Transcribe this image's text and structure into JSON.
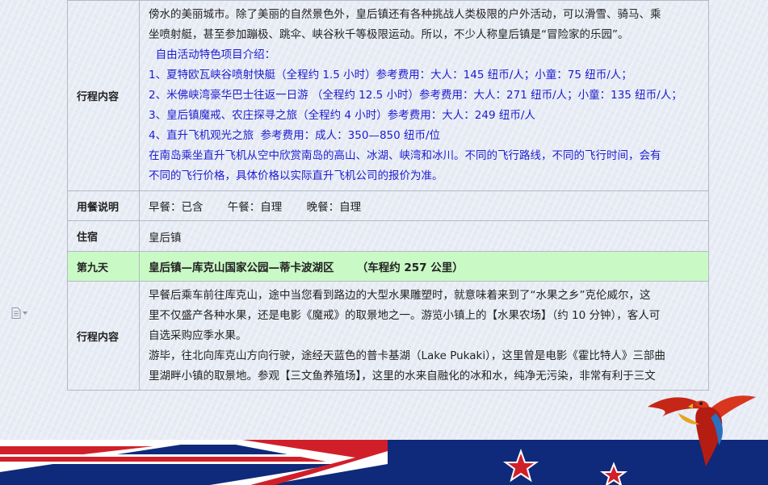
{
  "rows": [
    {
      "label": "行程内容",
      "lines": [
        "傍水的美丽城市。除了美丽的自然景色外，皇后镇还有各种挑战人类极限的户外活动，可以滑雪、骑马、乘",
        "坐喷射艇，甚至参加蹦极、跳伞、峡谷秋千等极限运动。所以，不少人称皇后镇是“冒险家的乐园”。"
      ],
      "blue_lines": [
        "  自由活动特色项目介绍：",
        "1、夏特欧瓦峡谷喷射快艇（全程约 1.5 小时）参考费用：大人：145 纽币/人；小童：75 纽币/人；",
        "2、米佛峡湾豪华巴士往返一日游 （全程约 12.5 小时）参考费用：大人：271 纽币/人；小童：135 纽币/人；",
        "3、皇后镇魔戒、农庄探寻之旅（全程约 4 小时）参考费用：大人：249 纽币/人",
        "4、直升飞机观光之旅  参考费用：成人：350—850 纽币/位",
        "在南岛乘坐直升飞机从空中欣赏南岛的高山、冰湖、峡湾和冰川。不同的飞行路线，不同的飞行时间，会有",
        "不同的飞行价格，具体价格以实际直升飞机公司的报价为准。"
      ]
    },
    {
      "label": "用餐说明",
      "meals": [
        "早餐：已含",
        "午餐：自理",
        "晚餐：自理"
      ]
    },
    {
      "label": "住宿",
      "text": "皇后镇"
    },
    {
      "label": "第九天",
      "title": "皇后镇—库克山国家公园—蒂卡波湖区      （车程约 257 公里）"
    },
    {
      "label": "行程内容",
      "lines": [
        "早餐后乘车前往库克山，途中当您看到路边的大型水果雕塑时，就意味着来到了“水果之乡”克伦威尔，这",
        "里不仅盛产各种水果，还是电影《魔戒》的取景地之一。游览小镇上的【水果农场】（约 10 分钟），客人可",
        "自选采购应季水果。",
        "游毕，往北向库克山方向行驶，途经天蓝色的普卡基湖（Lake Pukaki），这里曾是电影《霍比特人》三部曲",
        "里湖畔小镇的取景地。参观【三文鱼养殖场】，这里的水来自融化的冰和水，纯净无污染，非常有利于三文"
      ]
    }
  ],
  "colors": {
    "day_row_bg": "#c9f9c5",
    "blue_text": "#1c1ccf",
    "border": "#b5b9c5",
    "flag_blue": "#0f2a7a",
    "flag_red": "#d11f2a"
  },
  "icons": {
    "side_icon": "page-options-icon",
    "decor": [
      "union-jack-flag",
      "red-parrot",
      "red-star-icon"
    ]
  }
}
